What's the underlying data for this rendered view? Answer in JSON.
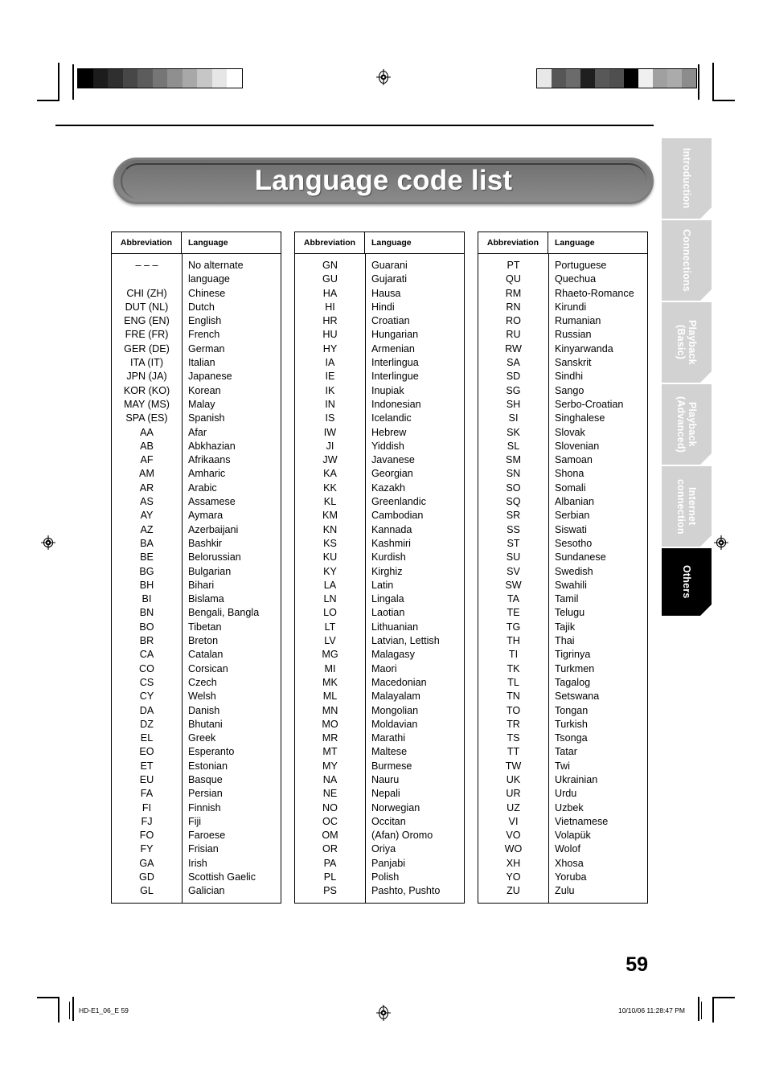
{
  "title": "Language code list",
  "page_number": "59",
  "footer": {
    "left": "HD-E1_06_E  59",
    "right": "10/10/06   11:28:47 PM"
  },
  "side_tabs": [
    {
      "label": "Introduction",
      "active": false
    },
    {
      "label": "Connections",
      "active": false
    },
    {
      "label": "Playback\n(Basic)",
      "active": false
    },
    {
      "label": "Playback\n(Advanced)",
      "active": false
    },
    {
      "label": "Internet\nconnection",
      "active": false
    },
    {
      "label": "Others",
      "active": true
    }
  ],
  "table_headers": {
    "abbreviation": "Abbreviation",
    "language": "Language"
  },
  "gray_bars": {
    "left": [
      "#000000",
      "#1c1c1c",
      "#2f2f2f",
      "#474747",
      "#5c5c5c",
      "#767676",
      "#8f8f8f",
      "#a8a8a8",
      "#c6c6c6",
      "#e6e6e6",
      "#ffffff"
    ],
    "right": [
      "#e8e8e8",
      "#565656",
      "#6b6b6b",
      "#1f1f1f",
      "#585858",
      "#4f4f4f",
      "#000000",
      "#f0f0f0",
      "#a0a0a0",
      "#ababab",
      "#8c8c8c"
    ]
  },
  "columns": [
    {
      "rows": [
        {
          "abbr": "– – –",
          "lang": "No alternate",
          "lang2": "language"
        },
        {
          "abbr": "CHI (ZH)",
          "lang": "Chinese"
        },
        {
          "abbr": "DUT (NL)",
          "lang": "Dutch"
        },
        {
          "abbr": "ENG (EN)",
          "lang": "English"
        },
        {
          "abbr": "FRE (FR)",
          "lang": "French"
        },
        {
          "abbr": "GER (DE)",
          "lang": "German"
        },
        {
          "abbr": "ITA (IT)",
          "lang": "Italian"
        },
        {
          "abbr": "JPN (JA)",
          "lang": "Japanese"
        },
        {
          "abbr": "KOR (KO)",
          "lang": "Korean"
        },
        {
          "abbr": "MAY (MS)",
          "lang": "Malay"
        },
        {
          "abbr": "SPA (ES)",
          "lang": "Spanish"
        },
        {
          "abbr": "AA",
          "lang": "Afar"
        },
        {
          "abbr": "AB",
          "lang": "Abkhazian"
        },
        {
          "abbr": "AF",
          "lang": "Afrikaans"
        },
        {
          "abbr": "AM",
          "lang": "Amharic"
        },
        {
          "abbr": "AR",
          "lang": "Arabic"
        },
        {
          "abbr": "AS",
          "lang": "Assamese"
        },
        {
          "abbr": "AY",
          "lang": "Aymara"
        },
        {
          "abbr": "AZ",
          "lang": "Azerbaijani"
        },
        {
          "abbr": "BA",
          "lang": "Bashkir"
        },
        {
          "abbr": "BE",
          "lang": "Belorussian"
        },
        {
          "abbr": "BG",
          "lang": "Bulgarian"
        },
        {
          "abbr": "BH",
          "lang": "Bihari"
        },
        {
          "abbr": "BI",
          "lang": "Bislama"
        },
        {
          "abbr": "BN",
          "lang": "Bengali, Bangla"
        },
        {
          "abbr": "BO",
          "lang": "Tibetan"
        },
        {
          "abbr": "BR",
          "lang": "Breton"
        },
        {
          "abbr": "CA",
          "lang": "Catalan"
        },
        {
          "abbr": "CO",
          "lang": "Corsican"
        },
        {
          "abbr": "CS",
          "lang": "Czech"
        },
        {
          "abbr": "CY",
          "lang": "Welsh"
        },
        {
          "abbr": "DA",
          "lang": "Danish"
        },
        {
          "abbr": "DZ",
          "lang": "Bhutani"
        },
        {
          "abbr": "EL",
          "lang": "Greek"
        },
        {
          "abbr": "EO",
          "lang": "Esperanto"
        },
        {
          "abbr": "ET",
          "lang": "Estonian"
        },
        {
          "abbr": "EU",
          "lang": "Basque"
        },
        {
          "abbr": "FA",
          "lang": "Persian"
        },
        {
          "abbr": "FI",
          "lang": "Finnish"
        },
        {
          "abbr": "FJ",
          "lang": "Fiji"
        },
        {
          "abbr": "FO",
          "lang": "Faroese"
        },
        {
          "abbr": "FY",
          "lang": "Frisian"
        },
        {
          "abbr": "GA",
          "lang": "Irish"
        },
        {
          "abbr": "GD",
          "lang": "Scottish Gaelic"
        },
        {
          "abbr": "GL",
          "lang": "Galician"
        }
      ]
    },
    {
      "rows": [
        {
          "abbr": "GN",
          "lang": "Guarani"
        },
        {
          "abbr": "GU",
          "lang": "Gujarati"
        },
        {
          "abbr": "HA",
          "lang": "Hausa"
        },
        {
          "abbr": "HI",
          "lang": "Hindi"
        },
        {
          "abbr": "HR",
          "lang": "Croatian"
        },
        {
          "abbr": "HU",
          "lang": "Hungarian"
        },
        {
          "abbr": "HY",
          "lang": "Armenian"
        },
        {
          "abbr": "IA",
          "lang": "Interlingua"
        },
        {
          "abbr": "IE",
          "lang": "Interlingue"
        },
        {
          "abbr": "IK",
          "lang": "Inupiak"
        },
        {
          "abbr": "IN",
          "lang": "Indonesian"
        },
        {
          "abbr": "IS",
          "lang": "Icelandic"
        },
        {
          "abbr": "IW",
          "lang": "Hebrew"
        },
        {
          "abbr": "JI",
          "lang": "Yiddish"
        },
        {
          "abbr": "JW",
          "lang": "Javanese"
        },
        {
          "abbr": "KA",
          "lang": "Georgian"
        },
        {
          "abbr": "KK",
          "lang": "Kazakh"
        },
        {
          "abbr": "KL",
          "lang": "Greenlandic"
        },
        {
          "abbr": "KM",
          "lang": "Cambodian"
        },
        {
          "abbr": "KN",
          "lang": "Kannada"
        },
        {
          "abbr": "KS",
          "lang": "Kashmiri"
        },
        {
          "abbr": "KU",
          "lang": "Kurdish"
        },
        {
          "abbr": "KY",
          "lang": "Kirghiz"
        },
        {
          "abbr": "LA",
          "lang": "Latin"
        },
        {
          "abbr": "LN",
          "lang": "Lingala"
        },
        {
          "abbr": "LO",
          "lang": "Laotian"
        },
        {
          "abbr": "LT",
          "lang": "Lithuanian"
        },
        {
          "abbr": "LV",
          "lang": "Latvian, Lettish"
        },
        {
          "abbr": "MG",
          "lang": "Malagasy"
        },
        {
          "abbr": "MI",
          "lang": "Maori"
        },
        {
          "abbr": "MK",
          "lang": "Macedonian"
        },
        {
          "abbr": "ML",
          "lang": "Malayalam"
        },
        {
          "abbr": "MN",
          "lang": "Mongolian"
        },
        {
          "abbr": "MO",
          "lang": "Moldavian"
        },
        {
          "abbr": "MR",
          "lang": "Marathi"
        },
        {
          "abbr": "MT",
          "lang": "Maltese"
        },
        {
          "abbr": "MY",
          "lang": "Burmese"
        },
        {
          "abbr": "NA",
          "lang": "Nauru"
        },
        {
          "abbr": "NE",
          "lang": "Nepali"
        },
        {
          "abbr": "NO",
          "lang": "Norwegian"
        },
        {
          "abbr": "OC",
          "lang": "Occitan"
        },
        {
          "abbr": "OM",
          "lang": "(Afan) Oromo"
        },
        {
          "abbr": "OR",
          "lang": "Oriya"
        },
        {
          "abbr": "PA",
          "lang": "Panjabi"
        },
        {
          "abbr": "PL",
          "lang": "Polish"
        },
        {
          "abbr": "PS",
          "lang": "Pashto, Pushto"
        }
      ]
    },
    {
      "rows": [
        {
          "abbr": "PT",
          "lang": "Portuguese"
        },
        {
          "abbr": "QU",
          "lang": "Quechua"
        },
        {
          "abbr": "RM",
          "lang": "Rhaeto-Romance"
        },
        {
          "abbr": "RN",
          "lang": "Kirundi"
        },
        {
          "abbr": "RO",
          "lang": "Rumanian"
        },
        {
          "abbr": "RU",
          "lang": "Russian"
        },
        {
          "abbr": "RW",
          "lang": "Kinyarwanda"
        },
        {
          "abbr": "SA",
          "lang": "Sanskrit"
        },
        {
          "abbr": "SD",
          "lang": "Sindhi"
        },
        {
          "abbr": "SG",
          "lang": "Sango"
        },
        {
          "abbr": "SH",
          "lang": "Serbo-Croatian"
        },
        {
          "abbr": "SI",
          "lang": "Singhalese"
        },
        {
          "abbr": "SK",
          "lang": "Slovak"
        },
        {
          "abbr": "SL",
          "lang": "Slovenian"
        },
        {
          "abbr": "SM",
          "lang": "Samoan"
        },
        {
          "abbr": "SN",
          "lang": "Shona"
        },
        {
          "abbr": "SO",
          "lang": "Somali"
        },
        {
          "abbr": "SQ",
          "lang": "Albanian"
        },
        {
          "abbr": "SR",
          "lang": "Serbian"
        },
        {
          "abbr": "SS",
          "lang": "Siswati"
        },
        {
          "abbr": "ST",
          "lang": "Sesotho"
        },
        {
          "abbr": "SU",
          "lang": "Sundanese"
        },
        {
          "abbr": "SV",
          "lang": "Swedish"
        },
        {
          "abbr": "SW",
          "lang": "Swahili"
        },
        {
          "abbr": "TA",
          "lang": "Tamil"
        },
        {
          "abbr": "TE",
          "lang": "Telugu"
        },
        {
          "abbr": "TG",
          "lang": "Tajik"
        },
        {
          "abbr": "TH",
          "lang": "Thai"
        },
        {
          "abbr": "TI",
          "lang": "Tigrinya"
        },
        {
          "abbr": "TK",
          "lang": "Turkmen"
        },
        {
          "abbr": "TL",
          "lang": "Tagalog"
        },
        {
          "abbr": "TN",
          "lang": "Setswana"
        },
        {
          "abbr": "TO",
          "lang": "Tongan"
        },
        {
          "abbr": "TR",
          "lang": "Turkish"
        },
        {
          "abbr": "TS",
          "lang": "Tsonga"
        },
        {
          "abbr": "TT",
          "lang": "Tatar"
        },
        {
          "abbr": "TW",
          "lang": "Twi"
        },
        {
          "abbr": "UK",
          "lang": "Ukrainian"
        },
        {
          "abbr": "UR",
          "lang": "Urdu"
        },
        {
          "abbr": "UZ",
          "lang": "Uzbek"
        },
        {
          "abbr": "VI",
          "lang": "Vietnamese"
        },
        {
          "abbr": "VO",
          "lang": "Volapük"
        },
        {
          "abbr": "WO",
          "lang": "Wolof"
        },
        {
          "abbr": "XH",
          "lang": "Xhosa"
        },
        {
          "abbr": "YO",
          "lang": "Yoruba"
        },
        {
          "abbr": "ZU",
          "lang": "Zulu"
        }
      ]
    }
  ]
}
